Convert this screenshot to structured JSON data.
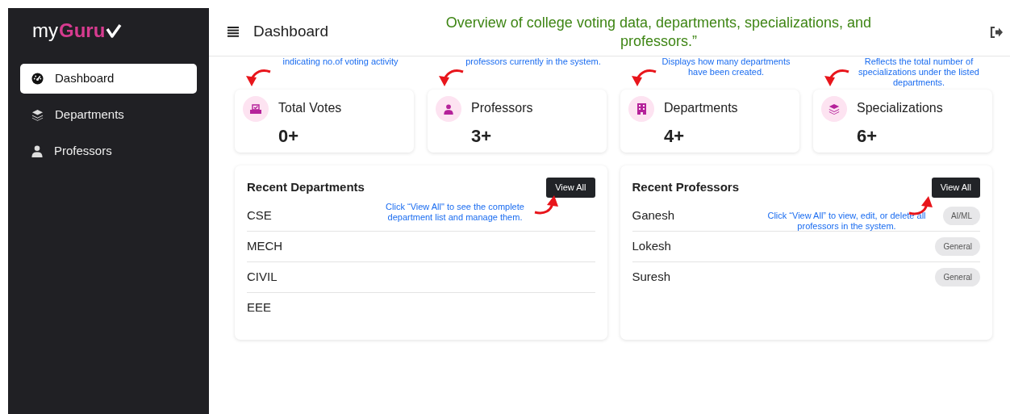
{
  "sidebar": {
    "logo": {
      "prefix": "my",
      "brand": "Guru"
    },
    "items": [
      {
        "label": "Dashboard",
        "selected": true
      },
      {
        "label": "Departments",
        "selected": false
      },
      {
        "label": "Professors",
        "selected": false
      }
    ]
  },
  "header": {
    "title": "Dashboard",
    "annotation": "Overview of college voting data, departments, specializations, and professors.”"
  },
  "stats": [
    {
      "label": "Total Votes",
      "value": "0+",
      "note": "indicating no.of voting activity"
    },
    {
      "label": "Professors",
      "value": "3+",
      "note": "professors currently in the system."
    },
    {
      "label": "Departments",
      "value": "4+",
      "note": "Displays how many departments have been created."
    },
    {
      "label": "Specializations",
      "value": "6+",
      "note": "Reflects the total number of specializations under the listed departments."
    }
  ],
  "recent_departments": {
    "title": "Recent Departments",
    "button": "View All",
    "note": "Click “View All\" to see the complete department list and manage them.",
    "rows": [
      "CSE",
      "MECH",
      "CIVIL",
      "EEE"
    ]
  },
  "recent_professors": {
    "title": "Recent Professors",
    "button": "View All",
    "note": "Click “View All” to view, edit, or delete all professors in the system.",
    "rows": [
      {
        "name": "Ganesh",
        "tag": "AI/ML"
      },
      {
        "name": "Lokesh",
        "tag": "General"
      },
      {
        "name": "Suresh",
        "tag": "General"
      }
    ]
  }
}
